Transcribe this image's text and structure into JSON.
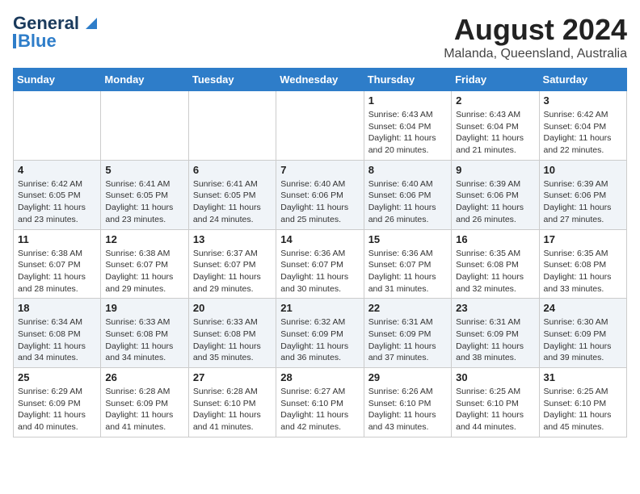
{
  "header": {
    "logo_general": "General",
    "logo_blue": "Blue",
    "title": "August 2024",
    "subtitle": "Malanda, Queensland, Australia"
  },
  "calendar": {
    "days_of_week": [
      "Sunday",
      "Monday",
      "Tuesday",
      "Wednesday",
      "Thursday",
      "Friday",
      "Saturday"
    ],
    "weeks": [
      [
        {
          "day": "",
          "info": ""
        },
        {
          "day": "",
          "info": ""
        },
        {
          "day": "",
          "info": ""
        },
        {
          "day": "",
          "info": ""
        },
        {
          "day": "1",
          "info": "Sunrise: 6:43 AM\nSunset: 6:04 PM\nDaylight: 11 hours\nand 20 minutes."
        },
        {
          "day": "2",
          "info": "Sunrise: 6:43 AM\nSunset: 6:04 PM\nDaylight: 11 hours\nand 21 minutes."
        },
        {
          "day": "3",
          "info": "Sunrise: 6:42 AM\nSunset: 6:04 PM\nDaylight: 11 hours\nand 22 minutes."
        }
      ],
      [
        {
          "day": "4",
          "info": "Sunrise: 6:42 AM\nSunset: 6:05 PM\nDaylight: 11 hours\nand 23 minutes."
        },
        {
          "day": "5",
          "info": "Sunrise: 6:41 AM\nSunset: 6:05 PM\nDaylight: 11 hours\nand 23 minutes."
        },
        {
          "day": "6",
          "info": "Sunrise: 6:41 AM\nSunset: 6:05 PM\nDaylight: 11 hours\nand 24 minutes."
        },
        {
          "day": "7",
          "info": "Sunrise: 6:40 AM\nSunset: 6:06 PM\nDaylight: 11 hours\nand 25 minutes."
        },
        {
          "day": "8",
          "info": "Sunrise: 6:40 AM\nSunset: 6:06 PM\nDaylight: 11 hours\nand 26 minutes."
        },
        {
          "day": "9",
          "info": "Sunrise: 6:39 AM\nSunset: 6:06 PM\nDaylight: 11 hours\nand 26 minutes."
        },
        {
          "day": "10",
          "info": "Sunrise: 6:39 AM\nSunset: 6:06 PM\nDaylight: 11 hours\nand 27 minutes."
        }
      ],
      [
        {
          "day": "11",
          "info": "Sunrise: 6:38 AM\nSunset: 6:07 PM\nDaylight: 11 hours\nand 28 minutes."
        },
        {
          "day": "12",
          "info": "Sunrise: 6:38 AM\nSunset: 6:07 PM\nDaylight: 11 hours\nand 29 minutes."
        },
        {
          "day": "13",
          "info": "Sunrise: 6:37 AM\nSunset: 6:07 PM\nDaylight: 11 hours\nand 29 minutes."
        },
        {
          "day": "14",
          "info": "Sunrise: 6:36 AM\nSunset: 6:07 PM\nDaylight: 11 hours\nand 30 minutes."
        },
        {
          "day": "15",
          "info": "Sunrise: 6:36 AM\nSunset: 6:07 PM\nDaylight: 11 hours\nand 31 minutes."
        },
        {
          "day": "16",
          "info": "Sunrise: 6:35 AM\nSunset: 6:08 PM\nDaylight: 11 hours\nand 32 minutes."
        },
        {
          "day": "17",
          "info": "Sunrise: 6:35 AM\nSunset: 6:08 PM\nDaylight: 11 hours\nand 33 minutes."
        }
      ],
      [
        {
          "day": "18",
          "info": "Sunrise: 6:34 AM\nSunset: 6:08 PM\nDaylight: 11 hours\nand 34 minutes."
        },
        {
          "day": "19",
          "info": "Sunrise: 6:33 AM\nSunset: 6:08 PM\nDaylight: 11 hours\nand 34 minutes."
        },
        {
          "day": "20",
          "info": "Sunrise: 6:33 AM\nSunset: 6:08 PM\nDaylight: 11 hours\nand 35 minutes."
        },
        {
          "day": "21",
          "info": "Sunrise: 6:32 AM\nSunset: 6:09 PM\nDaylight: 11 hours\nand 36 minutes."
        },
        {
          "day": "22",
          "info": "Sunrise: 6:31 AM\nSunset: 6:09 PM\nDaylight: 11 hours\nand 37 minutes."
        },
        {
          "day": "23",
          "info": "Sunrise: 6:31 AM\nSunset: 6:09 PM\nDaylight: 11 hours\nand 38 minutes."
        },
        {
          "day": "24",
          "info": "Sunrise: 6:30 AM\nSunset: 6:09 PM\nDaylight: 11 hours\nand 39 minutes."
        }
      ],
      [
        {
          "day": "25",
          "info": "Sunrise: 6:29 AM\nSunset: 6:09 PM\nDaylight: 11 hours\nand 40 minutes."
        },
        {
          "day": "26",
          "info": "Sunrise: 6:28 AM\nSunset: 6:09 PM\nDaylight: 11 hours\nand 41 minutes."
        },
        {
          "day": "27",
          "info": "Sunrise: 6:28 AM\nSunset: 6:10 PM\nDaylight: 11 hours\nand 41 minutes."
        },
        {
          "day": "28",
          "info": "Sunrise: 6:27 AM\nSunset: 6:10 PM\nDaylight: 11 hours\nand 42 minutes."
        },
        {
          "day": "29",
          "info": "Sunrise: 6:26 AM\nSunset: 6:10 PM\nDaylight: 11 hours\nand 43 minutes."
        },
        {
          "day": "30",
          "info": "Sunrise: 6:25 AM\nSunset: 6:10 PM\nDaylight: 11 hours\nand 44 minutes."
        },
        {
          "day": "31",
          "info": "Sunrise: 6:25 AM\nSunset: 6:10 PM\nDaylight: 11 hours\nand 45 minutes."
        }
      ]
    ]
  }
}
